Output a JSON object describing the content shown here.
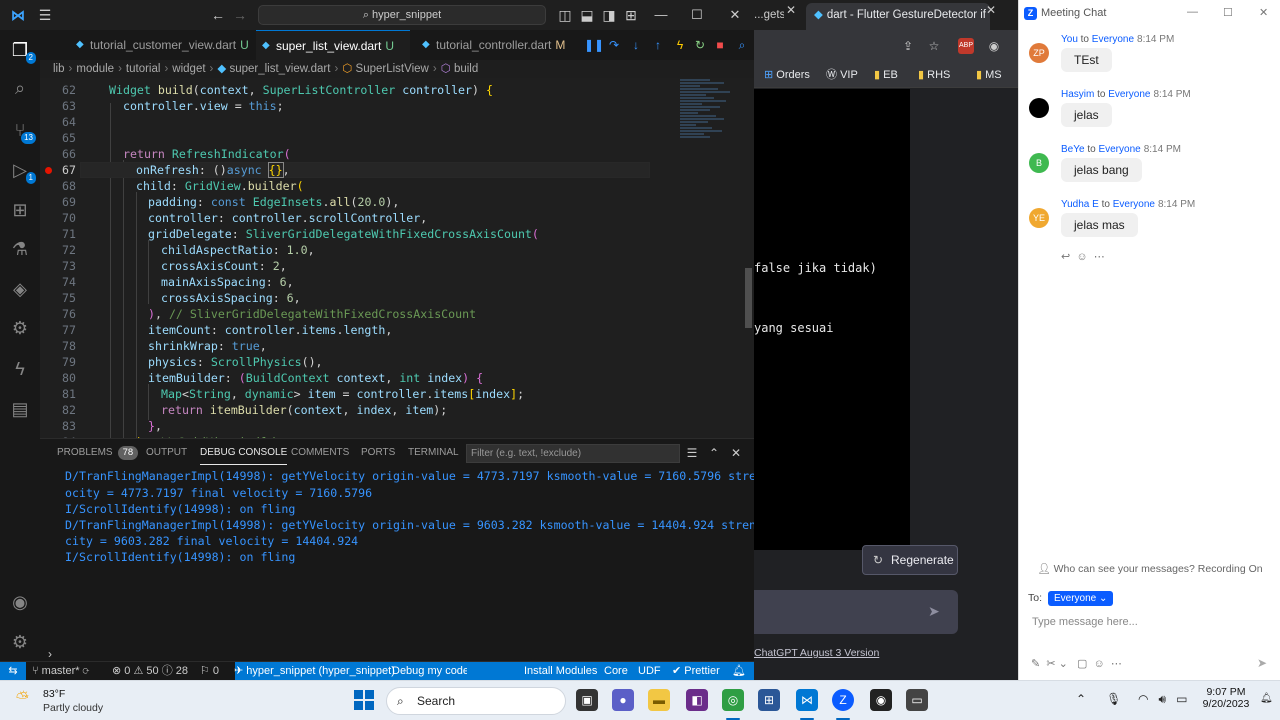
{
  "vscode": {
    "search_label": "hyper_snippet",
    "tabs": [
      {
        "label": "tutorial_customer_view.dart",
        "mark": "U"
      },
      {
        "label": "super_list_view.dart",
        "mark": "U"
      },
      {
        "label": "tutorial_controller.dart",
        "mark": "M"
      }
    ],
    "activity_badges": {
      "explorer": "2",
      "scm": "13",
      "run": "1"
    },
    "breadcrumb": [
      "lib",
      "module",
      "tutorial",
      "widget",
      "super_list_view.dart",
      "SuperListView",
      "build"
    ],
    "code_lines": [
      {
        "n": "62",
        "text": "Widget build(context, SuperListController controller) {"
      },
      {
        "n": "63",
        "text": "  controller.view = this;"
      },
      {
        "n": "64",
        "text": ""
      },
      {
        "n": "65",
        "text": ""
      },
      {
        "n": "66",
        "text": "  return RefreshIndicator("
      },
      {
        "n": "67",
        "text": "    onRefresh: ()async {},"
      },
      {
        "n": "68",
        "text": "    child: GridView.builder("
      },
      {
        "n": "69",
        "text": "      padding: const EdgeInsets.all(20.0),"
      },
      {
        "n": "70",
        "text": "      controller: controller.scrollController,"
      },
      {
        "n": "71",
        "text": "      gridDelegate: SliverGridDelegateWithFixedCrossAxisCount("
      },
      {
        "n": "72",
        "text": "        childAspectRatio: 1.0,"
      },
      {
        "n": "73",
        "text": "        crossAxisCount: 2,"
      },
      {
        "n": "74",
        "text": "        mainAxisSpacing: 6,"
      },
      {
        "n": "75",
        "text": "        crossAxisSpacing: 6,"
      },
      {
        "n": "76",
        "text": "      ), // SliverGridDelegateWithFixedCrossAxisCount"
      },
      {
        "n": "77",
        "text": "      itemCount: controller.items.length,"
      },
      {
        "n": "78",
        "text": "      shrinkWrap: true,"
      },
      {
        "n": "79",
        "text": "      physics: ScrollPhysics(),"
      },
      {
        "n": "80",
        "text": "      itemBuilder: (BuildContext context, int index) {"
      },
      {
        "n": "81",
        "text": "        Map<String, dynamic> item = controller.items[index];"
      },
      {
        "n": "82",
        "text": "        return itemBuilder(context, index, item);"
      },
      {
        "n": "83",
        "text": "      },"
      },
      {
        "n": "84",
        "text": "    ), // GridView.builder"
      }
    ],
    "panel": {
      "tabs": [
        "PROBLEMS",
        "OUTPUT",
        "DEBUG CONSOLE",
        "COMMENTS",
        "PORTS",
        "TERMINAL"
      ],
      "problems_count": "78",
      "filter_placeholder": "Filter (e.g. text, !exclude)",
      "console_lines": [
        "D/TranFlingManagerImpl(14998): getYVelocity origin-value = 4773.7197 ksmooth-value = 7160.5796 strengthVel",
        "ocity = 4773.7197 final velocity = 7160.5796",
        "I/ScrollIdentify(14998): on fling",
        "D/TranFlingManagerImpl(14998): getYVelocity origin-value = 9603.282 ksmooth-value = 14404.924 strengthVelo",
        "city = 9603.282 final velocity = 14404.924",
        "I/ScrollIdentify(14998): on fling"
      ]
    },
    "status": {
      "branch": "master*",
      "errors": "0",
      "warnings": "50",
      "info": "28",
      "ports": "0",
      "project": "hyper_snippet (hyper_snippet)",
      "debug": "Debug my code",
      "install": "Install Modules",
      "core": "Core",
      "udf": "UDF",
      "prettier": "Prettier"
    }
  },
  "browser": {
    "tabs": [
      "...gets",
      "dart - Flutter GestureDetector if"
    ],
    "bookmarks": [
      "Orders",
      "VIP",
      "EB",
      "RHS",
      "MS"
    ],
    "gpt_lines": [
      "false jika tidak)",
      "yang sesuai"
    ],
    "regenerate": "Regenerate",
    "footer": "ChatGPT August 3 Version"
  },
  "zoom": {
    "title": "Meeting Chat",
    "messages": [
      {
        "initials": "ZP",
        "color": "#e07a3a",
        "from": "You",
        "to": "Everyone",
        "time": "8:14 PM",
        "text": "TEst"
      },
      {
        "initials": "",
        "color": "#000000",
        "from": "Hasyim",
        "to": "Everyone",
        "time": "8:14 PM",
        "text": "jelas"
      },
      {
        "initials": "B",
        "color": "#3fb950",
        "from": "BeYe",
        "to": "Everyone",
        "time": "8:14 PM",
        "text": "jelas bang"
      },
      {
        "initials": "YE",
        "color": "#f0a830",
        "from": "Yudha E",
        "to": "Everyone",
        "time": "8:14 PM",
        "text": "jelas mas"
      }
    ],
    "to_word": "to",
    "who_can_see": "Who can see your messages? Recording On",
    "to_label": "To:",
    "to_value": "Everyone",
    "input_placeholder": "Type message here..."
  },
  "taskbar": {
    "temp": "83°F",
    "condition": "Partly cloudy",
    "search": "Search",
    "time": "9:07 PM",
    "date": "9/20/2023"
  }
}
